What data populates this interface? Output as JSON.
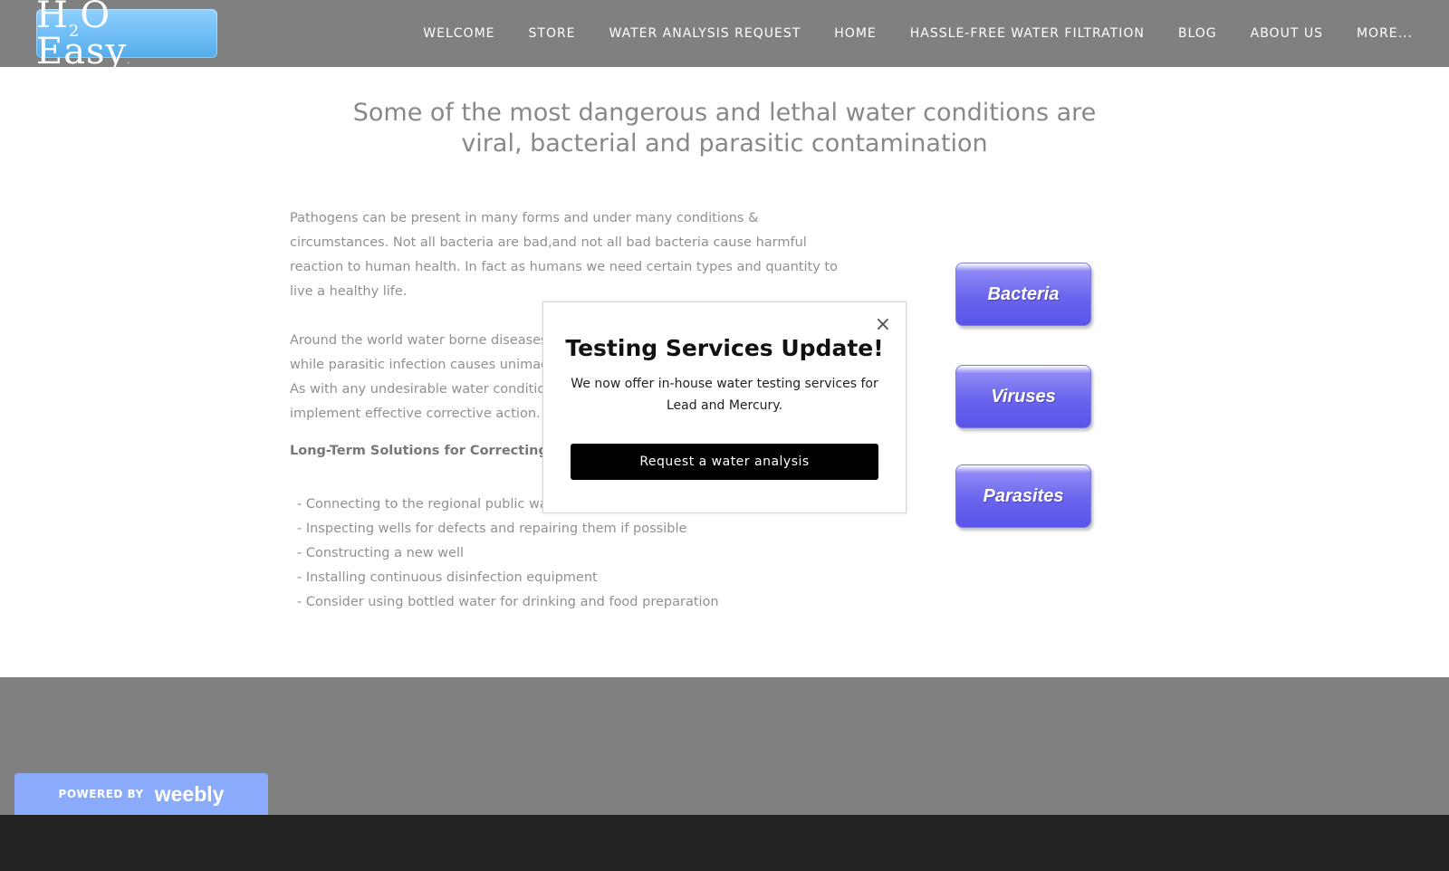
{
  "header": {
    "logo": {
      "main": "H",
      "sub": "2",
      "rest": "O Easy",
      "tm": "."
    },
    "nav": [
      "WELCOME",
      "STORE",
      "WATER ANALYSIS REQUEST",
      "HOME",
      "HASSLE-FREE WATER FILTRATION",
      "BLOG",
      "ABOUT US",
      "MORE..."
    ]
  },
  "main": {
    "title": "Some of the most dangerous and lethal water conditions are viral, bacterial and parasitic contamination",
    "paragraph1": "Pathogens can be present in many forms and under many conditions & circumstances. Not all bacteria are bad,and not all bad bacteria cause harmful reaction to human health. In fact as humans we need certain types and quantity to live a healthy life.",
    "paragraph2_lines": [
      "Around the world water borne diseases ar",
      "while parasitic infection causes unimagina",
      "As with any undesirable water condition, w",
      "implement effective corrective action."
    ],
    "solutions_heading": "Long-Term Solutions for Correcting Bacte",
    "solutions": [
      "- Connecting to the regional public wate",
      "- Inspecting wells for defects and repairing them if possible",
      "- Constructing a new well",
      "- Installing continuous disinfection equipment",
      "- Consider using bottled water for drinking and food preparation"
    ],
    "side_buttons": [
      "Bacteria",
      "Viruses",
      "Parasites"
    ]
  },
  "popup": {
    "close": "×",
    "title": "Testing Services Update!",
    "body": "We now offer in-house water testing services for Lead and Mercury.",
    "button": "Request a water analysis"
  },
  "footer": {
    "powered_by": "POWERED BY",
    "brand": "weebly"
  }
}
